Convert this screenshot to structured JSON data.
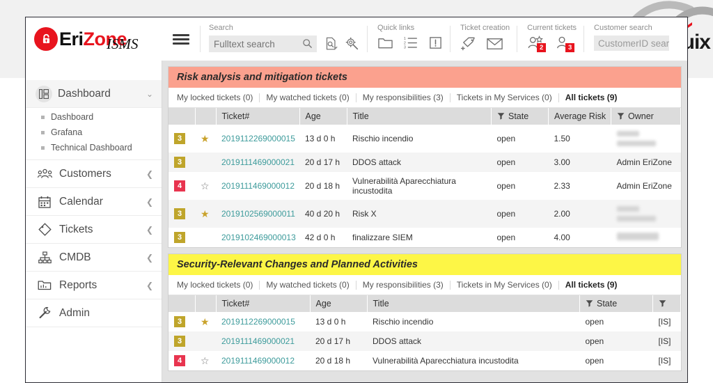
{
  "branding": {
    "name_part1": "Eri",
    "name_part2": "Z",
    "name_part3": "one",
    "subtitle": "ISMS",
    "watermark": "uix",
    "accent_red": "#e8141e",
    "teal": "#3d9b9b"
  },
  "toolbar": {
    "menu_icon": "hamburger-icon",
    "search": {
      "label": "Search",
      "placeholder": "Fulltext search",
      "value": "",
      "search_icon": "magnifier-icon",
      "detail_search_icon": "document-search-icon",
      "admin_search_icon": "gear-search-icon"
    },
    "quick_links": {
      "label": "Quick links",
      "items": [
        {
          "name": "folder-icon"
        },
        {
          "name": "list-icon"
        },
        {
          "name": "exclamation-icon"
        }
      ]
    },
    "ticket_creation": {
      "label": "Ticket creation",
      "items": [
        {
          "name": "new-phone-ticket-icon"
        },
        {
          "name": "new-email-ticket-icon"
        }
      ]
    },
    "current_tickets": {
      "label": "Current tickets",
      "items": [
        {
          "name": "my-tickets-icon",
          "badge": "2"
        },
        {
          "name": "customer-tickets-icon",
          "badge": "3"
        }
      ]
    },
    "customer_search": {
      "label": "Customer search",
      "placeholder": "CustomerID search",
      "value": ""
    }
  },
  "sidebar": {
    "items": [
      {
        "label": "Dashboard",
        "icon": "dashboard-icon",
        "active": true,
        "expanded": true,
        "chevron": "chevron-down-icon",
        "children": [
          {
            "label": "Dashboard"
          },
          {
            "label": "Grafana"
          },
          {
            "label": "Technical Dashboard"
          }
        ]
      },
      {
        "label": "Customers",
        "icon": "customers-icon",
        "chevron": "chevron-left-icon"
      },
      {
        "label": "Calendar",
        "icon": "calendar-icon",
        "chevron": "chevron-left-icon"
      },
      {
        "label": "Tickets",
        "icon": "tag-icon",
        "chevron": "chevron-left-icon"
      },
      {
        "label": "CMDB",
        "icon": "sitemap-icon",
        "chevron": "chevron-left-icon"
      },
      {
        "label": "Reports",
        "icon": "reports-icon",
        "chevron": "chevron-left-icon"
      },
      {
        "label": "Admin",
        "icon": "wrench-icon",
        "chevron": ""
      }
    ]
  },
  "widgets": [
    {
      "title": "Risk analysis and mitigation tickets",
      "header_color": "#fba18e",
      "tabs": [
        {
          "label": "My locked tickets (0)",
          "active": false
        },
        {
          "label": "My watched tickets (0)",
          "active": false
        },
        {
          "label": "My responsibilities (3)",
          "active": false
        },
        {
          "label": "Tickets in My Services (0)",
          "active": false
        },
        {
          "label": "All tickets (9)",
          "active": true
        }
      ],
      "columns": [
        {
          "label": "",
          "filter": false
        },
        {
          "label": "",
          "filter": false
        },
        {
          "label": "Ticket#",
          "filter": false
        },
        {
          "label": "Age",
          "filter": false
        },
        {
          "label": "Title",
          "filter": false
        },
        {
          "label": "State",
          "filter": true
        },
        {
          "label": "Average Risk",
          "filter": false
        },
        {
          "label": "Owner",
          "filter": true
        }
      ],
      "rows": [
        {
          "priority": "3",
          "priority_class": "p3",
          "starred": true,
          "ticket": "2019112269000015",
          "age": "13 d 0 h",
          "title": "Rischio incendio",
          "state": "open",
          "risk": "1.50",
          "owner": "",
          "owner_redacted": true
        },
        {
          "priority": "3",
          "priority_class": "p3",
          "starred": null,
          "ticket": "2019111469000021",
          "age": "20 d 17 h",
          "title": "DDOS attack",
          "state": "open",
          "risk": "3.00",
          "owner": "Admin EriZone",
          "owner_redacted": false
        },
        {
          "priority": "4",
          "priority_class": "p4",
          "starred": false,
          "ticket": "2019111469000012",
          "age": "20 d 18 h",
          "title": "Vulnerabilità Aparecchiatura incustodita",
          "state": "open",
          "risk": "2.33",
          "owner": "Admin EriZone",
          "owner_redacted": false
        },
        {
          "priority": "3",
          "priority_class": "p3",
          "starred": true,
          "ticket": "2019102569000011",
          "age": "40 d 20 h",
          "title": "Risk X",
          "state": "open",
          "risk": "2.00",
          "owner": "",
          "owner_redacted": true
        },
        {
          "priority": "3",
          "priority_class": "p3",
          "starred": null,
          "ticket": "2019102469000013",
          "age": "42 d 0 h",
          "title": "finalizzare SIEM",
          "state": "open",
          "risk": "4.00",
          "owner": "",
          "owner_redacted": true
        }
      ]
    },
    {
      "title": "Security-Relevant Changes and Planned Activities",
      "header_color": "#fdf646",
      "tabs": [
        {
          "label": "My locked tickets (0)",
          "active": false
        },
        {
          "label": "My watched tickets (0)",
          "active": false
        },
        {
          "label": "My responsibilities (3)",
          "active": false
        },
        {
          "label": "Tickets in My Services (0)",
          "active": false
        },
        {
          "label": "All tickets (9)",
          "active": true
        }
      ],
      "columns": [
        {
          "label": "",
          "filter": false
        },
        {
          "label": "",
          "filter": false
        },
        {
          "label": "Ticket#",
          "filter": false
        },
        {
          "label": "Age",
          "filter": false
        },
        {
          "label": "Title",
          "filter": false
        },
        {
          "label": "State",
          "filter": true
        },
        {
          "label": "",
          "filter": true
        }
      ],
      "rows": [
        {
          "priority": "3",
          "priority_class": "p3",
          "starred": true,
          "ticket": "2019112269000015",
          "age": "13 d 0 h",
          "title": "Rischio incendio",
          "state": "open",
          "extra": "[IS]"
        },
        {
          "priority": "3",
          "priority_class": "p3",
          "starred": null,
          "ticket": "2019111469000021",
          "age": "20 d 17 h",
          "title": "DDOS attack",
          "state": "open",
          "extra": "[IS]"
        },
        {
          "priority": "4",
          "priority_class": "p4",
          "starred": false,
          "ticket": "2019111469000012",
          "age": "20 d 18 h",
          "title": "Vulnerabilità Aparecchiatura incustodita",
          "state": "open",
          "extra": "[IS]"
        }
      ]
    }
  ]
}
